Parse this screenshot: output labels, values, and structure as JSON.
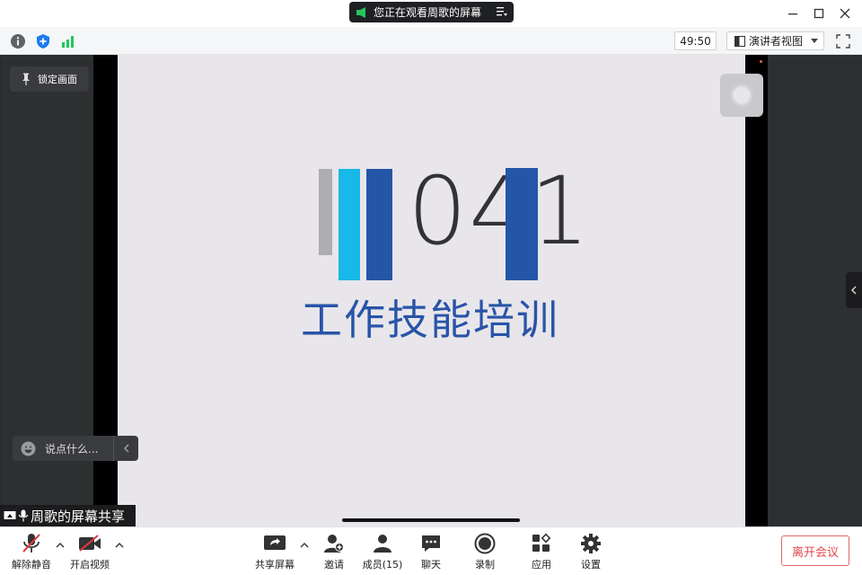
{
  "title_bar": {
    "share_status": "您正在观看周歌的屏幕"
  },
  "info_bar": {
    "timer": "49:50",
    "view_mode": "演讲者视图"
  },
  "stage": {
    "lock_screen_label": "锁定画面",
    "chat_placeholder": "说点什么...",
    "share_label": "周歌的屏幕共享"
  },
  "slide": {
    "number": "041",
    "title": "工作技能培训",
    "colors": {
      "gray_bar": "#aeadb1",
      "cyan_bar": "#18b8e8",
      "blue_bar": "#2456a8",
      "title": "#2854a8"
    }
  },
  "toolbar": {
    "unmute": "解除静音",
    "start_video": "开启视频",
    "share_screen": "共享屏幕",
    "invite": "邀请",
    "members": "成员(15)",
    "chat": "聊天",
    "record": "录制",
    "apps": "应用",
    "settings": "设置",
    "leave": "离开会议"
  }
}
